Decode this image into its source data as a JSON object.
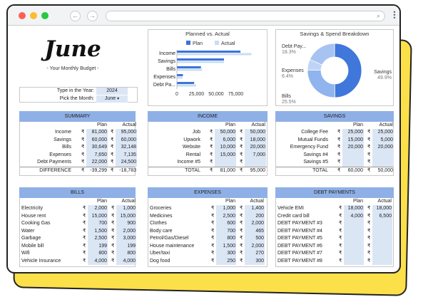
{
  "header": {
    "title": "June",
    "subtitle": "- Your Monthly Budget -"
  },
  "controls": {
    "type_label": "Type in the Year:",
    "year": "2024",
    "month_label": "Pick the Month:",
    "month": "June",
    "month_caret": "▾"
  },
  "colors": {
    "accent": "#8fb0e6",
    "plan": "#3d74d6",
    "actual": "#c9dcf6",
    "yellow": "#fbe04a",
    "red": "#ff5f57",
    "amber": "#fdbc2e",
    "green": "#27c93f"
  },
  "planned_vs_actual": {
    "chart_data": {
      "type": "bar",
      "title": "Planned vs. Actual",
      "legend_position": "top",
      "orientation": "horizontal",
      "categories": [
        "Income",
        "Savings",
        "Bills",
        "Expenses",
        "Debt Pa..."
      ],
      "series": [
        {
          "name": "Plan",
          "values": [
            81000,
            60000,
            30649,
            7650,
            22000
          ]
        },
        {
          "name": "Actual",
          "values": [
            95000,
            60000,
            32148,
            7135,
            24500
          ]
        }
      ],
      "xlim": [
        0,
        100000
      ],
      "xticks": [
        "0",
        "25,000",
        "50,000",
        "75,000"
      ]
    }
  },
  "breakdown": {
    "chart_data": {
      "type": "pie",
      "title": "Savings & Spend Breakdown",
      "donut": true,
      "labels": [
        "Savings",
        "Bills",
        "Expenses",
        "Debt Pay..."
      ],
      "values": [
        49.9,
        25.5,
        6.4,
        18.3
      ],
      "percent_labels": [
        "49.9%",
        "25.5%",
        "6.4%",
        "18.3%"
      ],
      "colors": [
        "#3f77da",
        "#8fb4ee",
        "#bed4f7",
        "#a6c3f1"
      ]
    }
  },
  "col": {
    "plan": "Plan",
    "actual": "Actual",
    "rupee": "₹"
  },
  "summary": {
    "title": "SUMMARY",
    "rows": [
      {
        "label": "Income",
        "plan": "81,000",
        "actual": "95,000"
      },
      {
        "label": "Savings",
        "plan": "60,000",
        "actual": "60,000"
      },
      {
        "label": "Bills",
        "plan": "30,649",
        "actual": "32,148"
      },
      {
        "label": "Expenses",
        "plan": "7,650",
        "actual": "7,135"
      },
      {
        "label": "Debt Payments",
        "plan": "22,000",
        "actual": "24,500"
      }
    ],
    "total": {
      "label": "DIFFERENCE",
      "plan": "-39,299",
      "actual": "-18,783"
    }
  },
  "income": {
    "title": "INCOME",
    "rows": [
      {
        "label": "Job",
        "plan": "50,000",
        "actual": "50,000"
      },
      {
        "label": "Upwork",
        "plan": "6,000",
        "actual": "18,000"
      },
      {
        "label": "Website",
        "plan": "10,000",
        "actual": "20,000"
      },
      {
        "label": "Rental",
        "plan": "15,000",
        "actual": "7,000"
      },
      {
        "label": "Income #5",
        "plan": "",
        "actual": ""
      }
    ],
    "total": {
      "label": "TOTAL",
      "plan": "81,000",
      "actual": "95,000"
    }
  },
  "savings": {
    "title": "SAVINGS",
    "rows": [
      {
        "label": "College Fee",
        "plan": "25,000",
        "actual": "25,000"
      },
      {
        "label": "Mutual Funds",
        "plan": "15,000",
        "actual": "5,000"
      },
      {
        "label": "Emergency Fund",
        "plan": "20,000",
        "actual": "20,000"
      },
      {
        "label": "Savings #4",
        "plan": "",
        "actual": ""
      },
      {
        "label": "Savings #5",
        "plan": "",
        "actual": ""
      }
    ],
    "total": {
      "label": "TOTAL",
      "plan": "60,000",
      "actual": "50,000"
    }
  },
  "bills": {
    "title": "BILLS",
    "rows": [
      {
        "label": "Electricity",
        "plan": "2,000",
        "actual": "1,000"
      },
      {
        "label": "House rent",
        "plan": "15,000",
        "actual": "15,000"
      },
      {
        "label": "Cooking Gas",
        "plan": "700",
        "actual": "900"
      },
      {
        "label": "Water",
        "plan": "1,500",
        "actual": "2,000"
      },
      {
        "label": "Garbage",
        "plan": "2,500",
        "actual": "3,000"
      },
      {
        "label": "Mobile bill",
        "plan": "199",
        "actual": "199"
      },
      {
        "label": "Wifi",
        "plan": "800",
        "actual": "800"
      },
      {
        "label": "Vehicle Insurance",
        "plan": "4,000",
        "actual": "4,000"
      }
    ]
  },
  "expenses": {
    "title": "EXPENSES",
    "rows": [
      {
        "label": "Groceries",
        "plan": "1,000",
        "actual": "1,400"
      },
      {
        "label": "Medicines",
        "plan": "2,500",
        "actual": "200"
      },
      {
        "label": "Clothes",
        "plan": "600",
        "actual": "2,000"
      },
      {
        "label": "Body care",
        "plan": "700",
        "actual": "465"
      },
      {
        "label": "Petrol/Gas/Diesel",
        "plan": "800",
        "actual": "500"
      },
      {
        "label": "House maintenance",
        "plan": "1,500",
        "actual": "2,000"
      },
      {
        "label": "Uber/taxi",
        "plan": "300",
        "actual": "270"
      },
      {
        "label": "Dog food",
        "plan": "250",
        "actual": "300"
      }
    ]
  },
  "debt": {
    "title": "DEBT PAYMENTS",
    "rows": [
      {
        "label": "Vehicle EMI",
        "plan": "18,000",
        "actual": "18,000"
      },
      {
        "label": "Credit card bill",
        "plan": "4,000",
        "actual": "6,500"
      },
      {
        "label": "DEBT PAYMENT #3",
        "plan": "",
        "actual": ""
      },
      {
        "label": "DEBT PAYMENT #4",
        "plan": "",
        "actual": ""
      },
      {
        "label": "DEBT PAYMENT #5",
        "plan": "",
        "actual": ""
      },
      {
        "label": "DEBT PAYMENT #6",
        "plan": "",
        "actual": ""
      },
      {
        "label": "DEBT PAYMENT #7",
        "plan": "",
        "actual": ""
      },
      {
        "label": "DEBT PAYMENT #8",
        "plan": "",
        "actual": ""
      }
    ]
  }
}
